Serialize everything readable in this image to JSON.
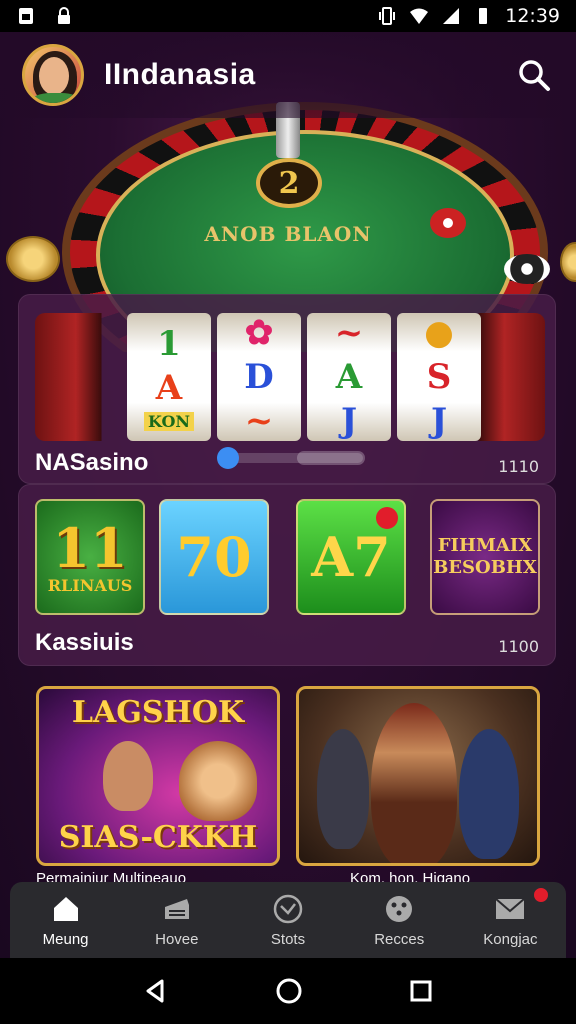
{
  "status_bar": {
    "time": "12:39",
    "icons": [
      "sim-icon",
      "lock-icon",
      "vibrate-icon",
      "wifi-icon",
      "signal-icon",
      "battery-icon"
    ]
  },
  "header": {
    "title": "IIndanasia",
    "search_icon": "search-icon"
  },
  "hero": {
    "badge": "2",
    "label": "ANOB BLAON"
  },
  "slot_section": {
    "label": "NASasino",
    "count": "1110",
    "reels": [
      [
        "1",
        "A",
        "KON"
      ],
      [
        "✿",
        "D",
        "~"
      ],
      [
        "~",
        "A",
        "J"
      ],
      [
        "●",
        "S",
        "J"
      ]
    ]
  },
  "games_section": {
    "label": "Kassiuis",
    "count": "1100",
    "tiles": [
      {
        "big": "11",
        "text": "RLINAUS"
      },
      {
        "text": "70"
      },
      {
        "text": "A7"
      },
      {
        "text": "FIHMAIX BESOBHX"
      }
    ]
  },
  "cards": [
    {
      "head": "LAGSHOK",
      "foot": "SIAS-CKKH",
      "caption": "Permainiur Multipeauo"
    },
    {
      "caption": "Kom. hon. Higano"
    }
  ],
  "bottom_nav": [
    {
      "label": "Meung",
      "icon": "home-icon",
      "active": true
    },
    {
      "label": "Hovee",
      "icon": "cabinet-icon"
    },
    {
      "label": "Stots",
      "icon": "clock-icon"
    },
    {
      "label": "Recces",
      "icon": "dice-icon"
    },
    {
      "label": "Kongjac",
      "icon": "mail-icon",
      "badge": true
    }
  ],
  "colors": {
    "background": "#2a0c2e",
    "accent_gold": "#d9a640",
    "panel": "#461c46",
    "nav_bg": "#2a2a2e",
    "badge_red": "#e11d2b",
    "slider_blue": "#3c8ef3"
  }
}
